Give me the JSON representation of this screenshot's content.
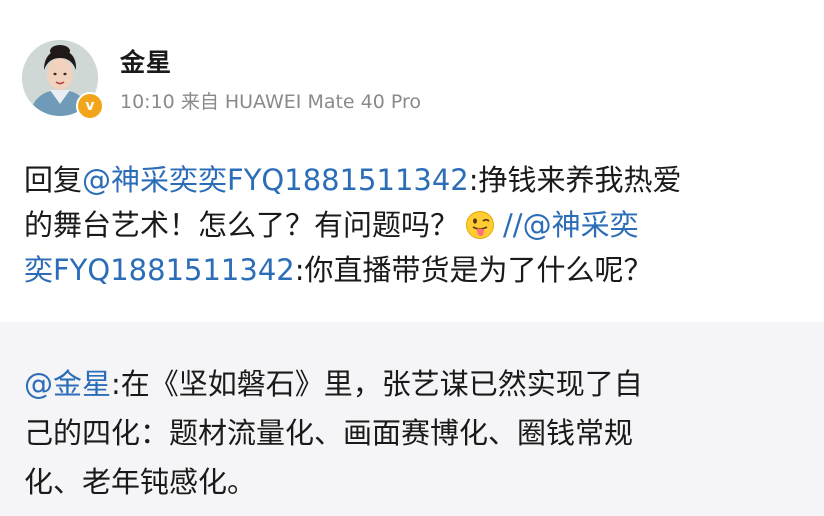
{
  "post": {
    "username": "金星",
    "time": "10:10",
    "source": "来自 HUAWEI Mate 40 Pro",
    "verified_badge": "v",
    "avatar_icon": "avatar-photo-icon",
    "content": {
      "line1_prefix": "回复",
      "line1_mention": "@神采奕奕FYQ1881511342",
      "line1_text": ":挣钱来养我热爱",
      "line2_text": "的舞台艺术！怎么了？有问题吗？",
      "line2_emoji": "tongue-out-emoji-icon",
      "line2_sep": "//",
      "line2_mention": "@神采奕",
      "line3_mention": "奕FYQ1881511342",
      "line3_text": ":你直播带货是为了什么呢？"
    }
  },
  "reply": {
    "mention": "@金星",
    "line1_text": ":在《坚如磐石》里，张艺谋已然实现了自",
    "line2_text": "己的四化：题材流量化、画面赛博化、圈钱常规",
    "line3_text": "化、老年钝感化。"
  },
  "colors": {
    "link": "#2c6db8",
    "text": "#1a1a1a",
    "meta": "#8a8a8a",
    "reply_bg": "#f5f5f7",
    "badge": "#f2a51a"
  }
}
